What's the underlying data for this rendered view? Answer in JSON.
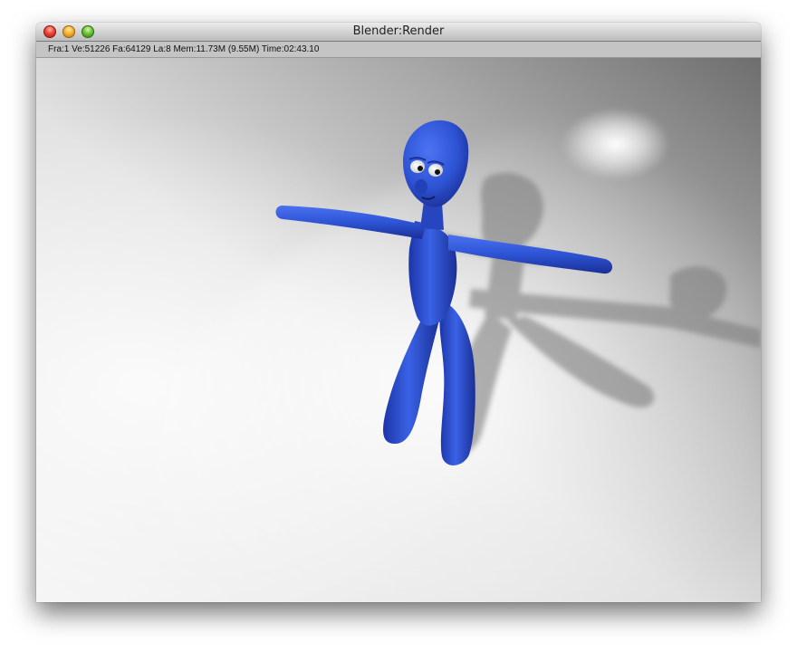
{
  "window": {
    "title": "Blender:Render"
  },
  "render_info": {
    "stats": "Fra:1  Ve:51226 Fa:64129 La:8 Mem:11.73M (9.55M) Time:02:43.10"
  },
  "colors": {
    "character": "#2e54d6",
    "floor_light": "#f2f2f2",
    "floor_dark": "#7a7a7a",
    "shadow": "#7d7d7d"
  }
}
